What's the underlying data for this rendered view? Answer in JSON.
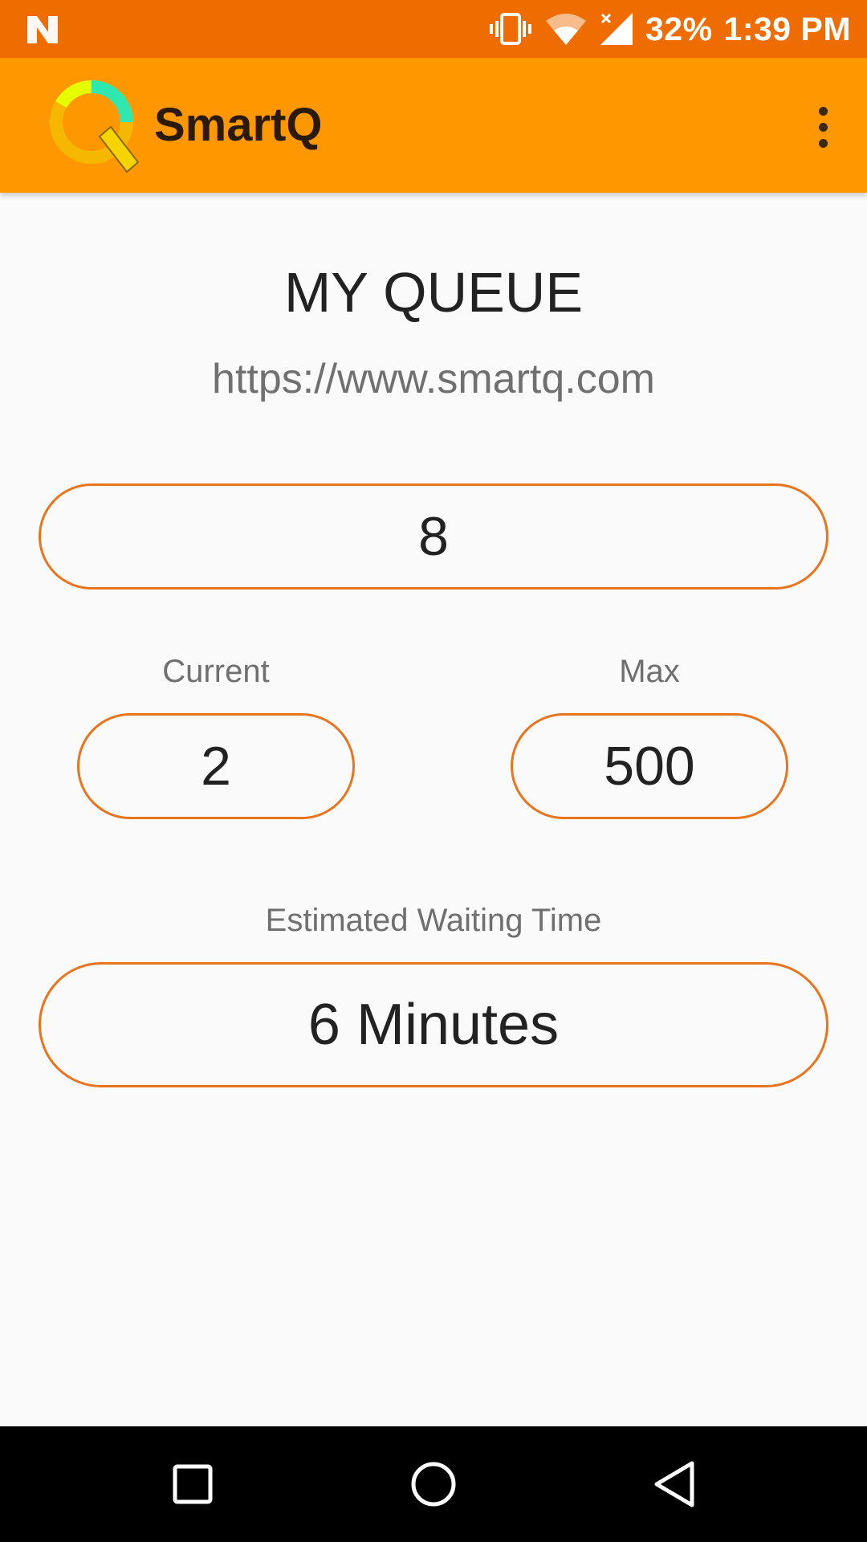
{
  "status_bar": {
    "battery_percent": "32%",
    "time": "1:39 PM",
    "icons": [
      "notification-n-icon",
      "vibrate-icon",
      "wifi-icon",
      "cell-signal-icon"
    ]
  },
  "app_bar": {
    "title": "SmartQ",
    "logo": "smartq-logo",
    "menu_icon": "overflow-menu-icon"
  },
  "queue": {
    "title": "MY QUEUE",
    "url": "https://www.smartq.com",
    "number": "8",
    "current_label": "Current",
    "current_value": "2",
    "max_label": "Max",
    "max_value": "500",
    "wait_label": "Estimated Waiting Time",
    "wait_value": "6 Minutes"
  },
  "nav_bar": {
    "icons": [
      "recents-square-icon",
      "home-circle-icon",
      "back-triangle-icon"
    ]
  },
  "colors": {
    "status_bar": "#ef6c00",
    "app_bar": "#ff9800",
    "pill_border": "#e8741e",
    "background": "#fafafa",
    "nav_bar": "#000000"
  }
}
